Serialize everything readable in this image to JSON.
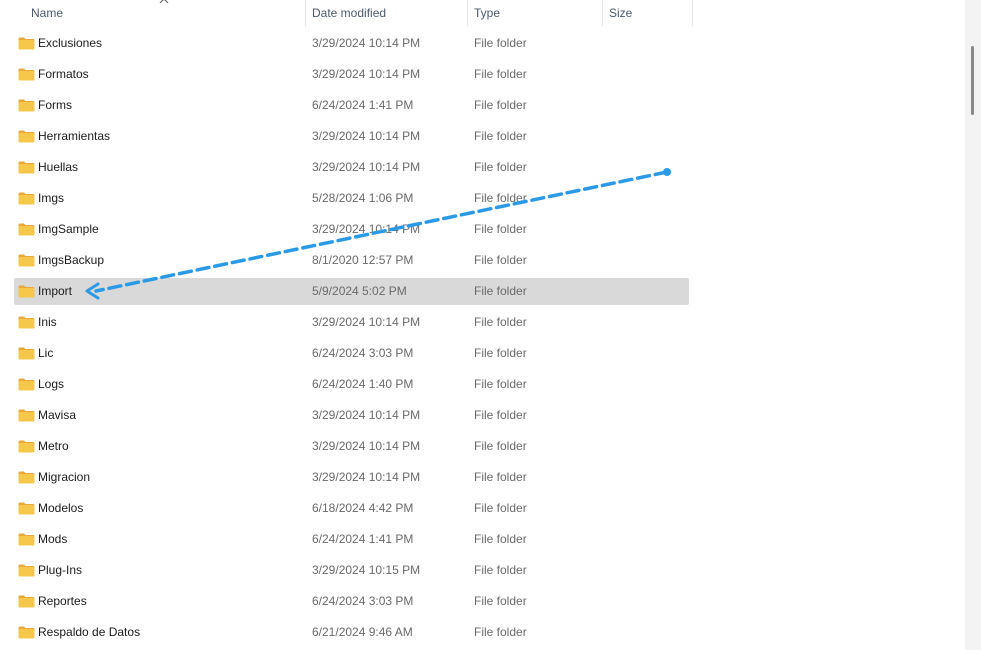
{
  "columns": {
    "name": "Name",
    "date": "Date modified",
    "type": "Type",
    "size": "Size"
  },
  "sort": {
    "column": "name",
    "icon": "chevron-up-icon"
  },
  "icons": {
    "folder": "folder-icon",
    "folder_color": "#f5c84c",
    "folder_tab_color": "#e8a93a"
  },
  "annotation": {
    "type": "dashed-arrow",
    "color": "#2b9ae6",
    "target": "Import"
  },
  "selected_row": "Import",
  "files": [
    {
      "name": "Exclusiones",
      "date": "3/29/2024 10:14 PM",
      "type": "File folder"
    },
    {
      "name": "Formatos",
      "date": "3/29/2024 10:14 PM",
      "type": "File folder"
    },
    {
      "name": "Forms",
      "date": "6/24/2024 1:41 PM",
      "type": "File folder"
    },
    {
      "name": "Herramientas",
      "date": "3/29/2024 10:14 PM",
      "type": "File folder"
    },
    {
      "name": "Huellas",
      "date": "3/29/2024 10:14 PM",
      "type": "File folder"
    },
    {
      "name": "Imgs",
      "date": "5/28/2024 1:06 PM",
      "type": "File folder"
    },
    {
      "name": "ImgSample",
      "date": "3/29/2024 10:14 PM",
      "type": "File folder"
    },
    {
      "name": "ImgsBackup",
      "date": "8/1/2020 12:57 PM",
      "type": "File folder"
    },
    {
      "name": "Import",
      "date": "5/9/2024 5:02 PM",
      "type": "File folder"
    },
    {
      "name": "Inis",
      "date": "3/29/2024 10:14 PM",
      "type": "File folder"
    },
    {
      "name": "Lic",
      "date": "6/24/2024 3:03 PM",
      "type": "File folder"
    },
    {
      "name": "Logs",
      "date": "6/24/2024 1:40 PM",
      "type": "File folder"
    },
    {
      "name": "Mavisa",
      "date": "3/29/2024 10:14 PM",
      "type": "File folder"
    },
    {
      "name": "Metro",
      "date": "3/29/2024 10:14 PM",
      "type": "File folder"
    },
    {
      "name": "Migracion",
      "date": "3/29/2024 10:14 PM",
      "type": "File folder"
    },
    {
      "name": "Modelos",
      "date": "6/18/2024 4:42 PM",
      "type": "File folder"
    },
    {
      "name": "Mods",
      "date": "6/24/2024 1:41 PM",
      "type": "File folder"
    },
    {
      "name": "Plug-Ins",
      "date": "3/29/2024 10:15 PM",
      "type": "File folder"
    },
    {
      "name": "Reportes",
      "date": "6/24/2024 3:03 PM",
      "type": "File folder"
    },
    {
      "name": "Respaldo de Datos",
      "date": "6/21/2024 9:46 AM",
      "type": "File folder"
    }
  ]
}
